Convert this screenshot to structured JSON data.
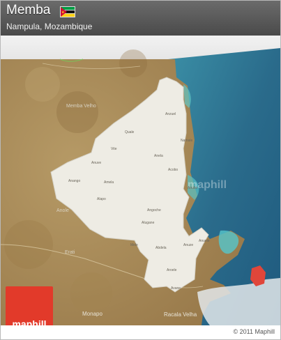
{
  "header": {
    "title": "Memba",
    "subtitle": "Nampula, Mozambique"
  },
  "map": {
    "watermark": "maphill",
    "places_inside": [
      "Anzuel",
      "Quale",
      "Vite",
      "Anela",
      "Anango",
      "Amela",
      "Acobo",
      "Namale",
      "Alapo",
      "Angoche",
      "Alugane",
      "Anubo",
      "Mele",
      "Abdela",
      "Anuele",
      "Anuze",
      "Aroele",
      "Avane",
      "Anuve"
    ],
    "places_outside": [
      "Memba Velho",
      "Erati",
      "Monapo",
      "Racala Velha",
      "Anole"
    ],
    "colors": {
      "region_fill": "#eeece4",
      "land": "#b29563",
      "sea": "#2f6f8f",
      "highlight": "#e0463a"
    }
  },
  "logo": {
    "text": "maphill"
  },
  "footer": {
    "copyright": "© 2011 Maphill"
  }
}
